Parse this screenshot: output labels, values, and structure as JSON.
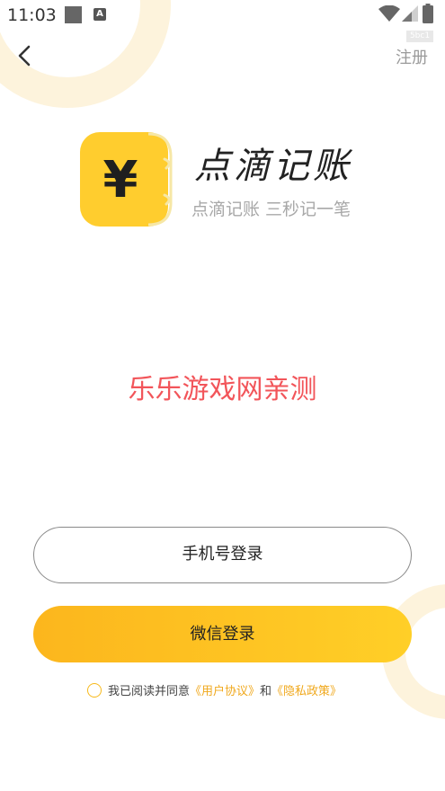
{
  "status_bar": {
    "time": "11:03",
    "keyboard_badge": "A"
  },
  "debug_label": "5bc1",
  "nav": {
    "register_label": "注册"
  },
  "brand": {
    "name": "点滴记账",
    "slogan": "点滴记账  三秒记一笔",
    "logo_symbol": "¥"
  },
  "watermark": "乐乐游戏网亲测",
  "buttons": {
    "phone_login": "手机号登录",
    "wechat_login": "微信登录"
  },
  "agreement": {
    "prefix": "我已阅读并同意",
    "user_agreement": "《用户协议》",
    "joiner": "和",
    "privacy_policy": "《隐私政策》"
  },
  "colors": {
    "accent_yellow": "#fcc22b",
    "link_orange": "#f0a81c",
    "watermark_red": "#f2555a",
    "decor_ring": "#fdf3dc"
  },
  "icons": {
    "back": "chevron-left-icon",
    "wifi": "wifi-icon",
    "signal": "cell-signal-icon",
    "battery": "battery-icon",
    "checkbox": "radio-circle-icon"
  }
}
